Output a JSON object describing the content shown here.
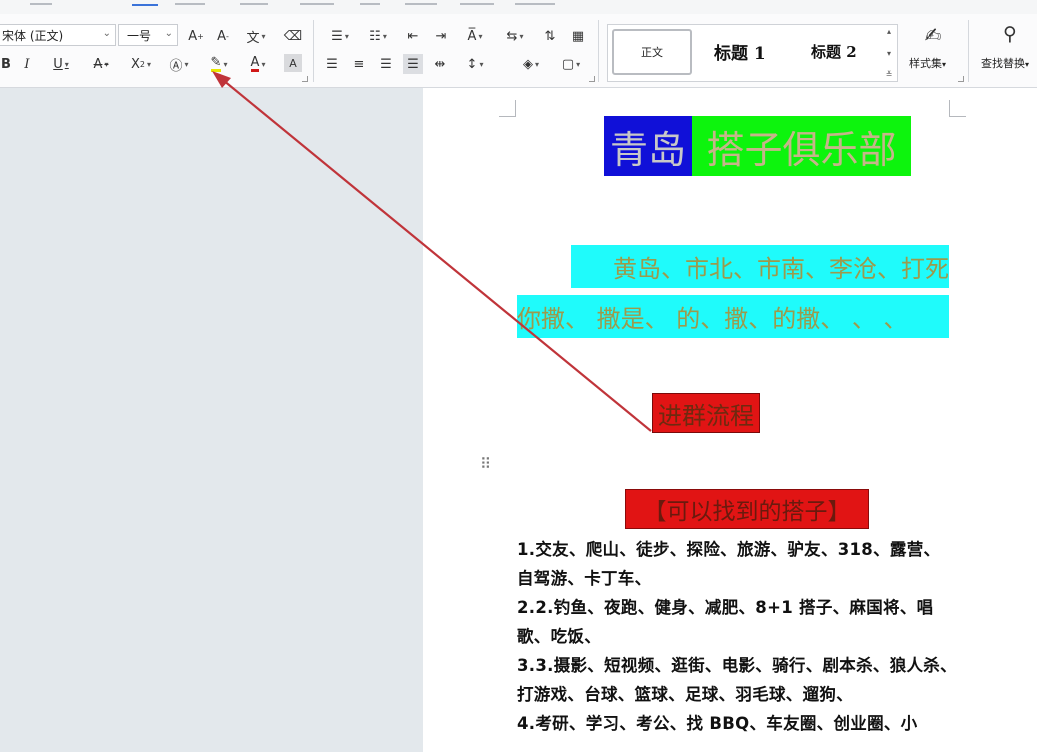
{
  "ribbon": {
    "font_name": "宋体 (正文)",
    "font_size": "一号",
    "styles": {
      "normal": "正文",
      "heading1": "标题 1",
      "heading2": "标题 2",
      "style_set_label": "样式集",
      "find_replace_label": "查找替换"
    }
  },
  "document": {
    "title_part1": "青岛",
    "title_part2": "搭子俱乐部",
    "line1": "黄岛、市北、市南、李沧、打死",
    "line2": "你撒、 撒是、 的、撒、的撒、 、 、",
    "join_flow": "进群流程",
    "section_heading": "【可以找到的搭子】",
    "body": [
      "1.交友、爬山、徒步、探险、旅游、驴友、318、露营、自驾游、卡丁车、",
      "2.2.钓鱼、夜跑、健身、减肥、8+1 搭子、麻国将、唱歌、吃饭、",
      "3.3.摄影、短视频、逛街、电影、骑行、剧本杀、狼人杀、打游戏、台球、篮球、足球、羽毛球、遛狗、",
      "4.考研、学习、考公、找 BBQ、车友圈、创业圈、小"
    ]
  },
  "colors": {
    "title_bg1": "#1010d8",
    "title_bg2": "#0df40d",
    "cyan_highlight": "#1ffbfb",
    "red_highlight": "#e11414",
    "arrow": "#c0343a"
  },
  "icons": [
    "increase-font-icon",
    "decrease-font-icon",
    "phonetic-icon",
    "clear-format-icon",
    "bold-icon",
    "italic-icon",
    "underline-icon",
    "strikethrough-icon",
    "superscript-icon",
    "text-effect-icon",
    "highlight-icon",
    "font-color-icon",
    "char-shading-icon",
    "bullets-icon",
    "numbering-icon",
    "decrease-indent-icon",
    "increase-indent-icon",
    "char-scaling-icon",
    "text-direction-icon",
    "sort-icon",
    "table-icon",
    "align-left-icon",
    "align-center-icon",
    "align-right-icon",
    "justify-icon",
    "distributed-icon",
    "line-spacing-icon",
    "paragraph-shading-icon",
    "border-icon",
    "style-set-icon",
    "search-icon",
    "drag-handle-icon"
  ]
}
